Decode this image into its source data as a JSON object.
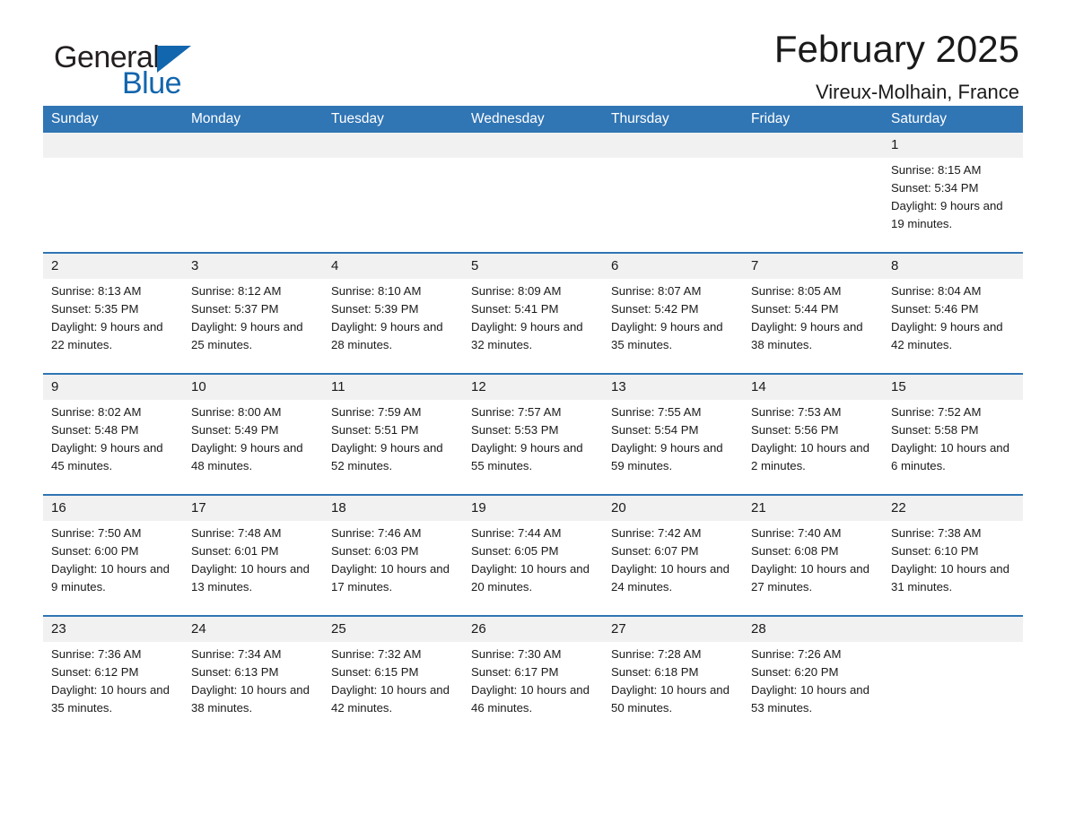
{
  "brand": {
    "name_top": "General",
    "name_bottom": "Blue",
    "accent_color": "#1266ae"
  },
  "header": {
    "title": "February 2025",
    "subtitle": "Vireux-Molhain, France"
  },
  "theme": {
    "header_blue": "#3075b4",
    "daynum_gray": "#f1f1f1",
    "text": "#1a1a1a"
  },
  "calendar": {
    "weekday_headers": [
      "Sunday",
      "Monday",
      "Tuesday",
      "Wednesday",
      "Thursday",
      "Friday",
      "Saturday"
    ],
    "labels": {
      "sunrise": "Sunrise:",
      "sunset": "Sunset:",
      "daylight": "Daylight:"
    },
    "weeks": [
      [
        {
          "day": "",
          "sunrise": "",
          "sunset": "",
          "daylight": ""
        },
        {
          "day": "",
          "sunrise": "",
          "sunset": "",
          "daylight": ""
        },
        {
          "day": "",
          "sunrise": "",
          "sunset": "",
          "daylight": ""
        },
        {
          "day": "",
          "sunrise": "",
          "sunset": "",
          "daylight": ""
        },
        {
          "day": "",
          "sunrise": "",
          "sunset": "",
          "daylight": ""
        },
        {
          "day": "",
          "sunrise": "",
          "sunset": "",
          "daylight": ""
        },
        {
          "day": "1",
          "sunrise": "Sunrise: 8:15 AM",
          "sunset": "Sunset: 5:34 PM",
          "daylight": "Daylight: 9 hours and 19 minutes."
        }
      ],
      [
        {
          "day": "2",
          "sunrise": "Sunrise: 8:13 AM",
          "sunset": "Sunset: 5:35 PM",
          "daylight": "Daylight: 9 hours and 22 minutes."
        },
        {
          "day": "3",
          "sunrise": "Sunrise: 8:12 AM",
          "sunset": "Sunset: 5:37 PM",
          "daylight": "Daylight: 9 hours and 25 minutes."
        },
        {
          "day": "4",
          "sunrise": "Sunrise: 8:10 AM",
          "sunset": "Sunset: 5:39 PM",
          "daylight": "Daylight: 9 hours and 28 minutes."
        },
        {
          "day": "5",
          "sunrise": "Sunrise: 8:09 AM",
          "sunset": "Sunset: 5:41 PM",
          "daylight": "Daylight: 9 hours and 32 minutes."
        },
        {
          "day": "6",
          "sunrise": "Sunrise: 8:07 AM",
          "sunset": "Sunset: 5:42 PM",
          "daylight": "Daylight: 9 hours and 35 minutes."
        },
        {
          "day": "7",
          "sunrise": "Sunrise: 8:05 AM",
          "sunset": "Sunset: 5:44 PM",
          "daylight": "Daylight: 9 hours and 38 minutes."
        },
        {
          "day": "8",
          "sunrise": "Sunrise: 8:04 AM",
          "sunset": "Sunset: 5:46 PM",
          "daylight": "Daylight: 9 hours and 42 minutes."
        }
      ],
      [
        {
          "day": "9",
          "sunrise": "Sunrise: 8:02 AM",
          "sunset": "Sunset: 5:48 PM",
          "daylight": "Daylight: 9 hours and 45 minutes."
        },
        {
          "day": "10",
          "sunrise": "Sunrise: 8:00 AM",
          "sunset": "Sunset: 5:49 PM",
          "daylight": "Daylight: 9 hours and 48 minutes."
        },
        {
          "day": "11",
          "sunrise": "Sunrise: 7:59 AM",
          "sunset": "Sunset: 5:51 PM",
          "daylight": "Daylight: 9 hours and 52 minutes."
        },
        {
          "day": "12",
          "sunrise": "Sunrise: 7:57 AM",
          "sunset": "Sunset: 5:53 PM",
          "daylight": "Daylight: 9 hours and 55 minutes."
        },
        {
          "day": "13",
          "sunrise": "Sunrise: 7:55 AM",
          "sunset": "Sunset: 5:54 PM",
          "daylight": "Daylight: 9 hours and 59 minutes."
        },
        {
          "day": "14",
          "sunrise": "Sunrise: 7:53 AM",
          "sunset": "Sunset: 5:56 PM",
          "daylight": "Daylight: 10 hours and 2 minutes."
        },
        {
          "day": "15",
          "sunrise": "Sunrise: 7:52 AM",
          "sunset": "Sunset: 5:58 PM",
          "daylight": "Daylight: 10 hours and 6 minutes."
        }
      ],
      [
        {
          "day": "16",
          "sunrise": "Sunrise: 7:50 AM",
          "sunset": "Sunset: 6:00 PM",
          "daylight": "Daylight: 10 hours and 9 minutes."
        },
        {
          "day": "17",
          "sunrise": "Sunrise: 7:48 AM",
          "sunset": "Sunset: 6:01 PM",
          "daylight": "Daylight: 10 hours and 13 minutes."
        },
        {
          "day": "18",
          "sunrise": "Sunrise: 7:46 AM",
          "sunset": "Sunset: 6:03 PM",
          "daylight": "Daylight: 10 hours and 17 minutes."
        },
        {
          "day": "19",
          "sunrise": "Sunrise: 7:44 AM",
          "sunset": "Sunset: 6:05 PM",
          "daylight": "Daylight: 10 hours and 20 minutes."
        },
        {
          "day": "20",
          "sunrise": "Sunrise: 7:42 AM",
          "sunset": "Sunset: 6:07 PM",
          "daylight": "Daylight: 10 hours and 24 minutes."
        },
        {
          "day": "21",
          "sunrise": "Sunrise: 7:40 AM",
          "sunset": "Sunset: 6:08 PM",
          "daylight": "Daylight: 10 hours and 27 minutes."
        },
        {
          "day": "22",
          "sunrise": "Sunrise: 7:38 AM",
          "sunset": "Sunset: 6:10 PM",
          "daylight": "Daylight: 10 hours and 31 minutes."
        }
      ],
      [
        {
          "day": "23",
          "sunrise": "Sunrise: 7:36 AM",
          "sunset": "Sunset: 6:12 PM",
          "daylight": "Daylight: 10 hours and 35 minutes."
        },
        {
          "day": "24",
          "sunrise": "Sunrise: 7:34 AM",
          "sunset": "Sunset: 6:13 PM",
          "daylight": "Daylight: 10 hours and 38 minutes."
        },
        {
          "day": "25",
          "sunrise": "Sunrise: 7:32 AM",
          "sunset": "Sunset: 6:15 PM",
          "daylight": "Daylight: 10 hours and 42 minutes."
        },
        {
          "day": "26",
          "sunrise": "Sunrise: 7:30 AM",
          "sunset": "Sunset: 6:17 PM",
          "daylight": "Daylight: 10 hours and 46 minutes."
        },
        {
          "day": "27",
          "sunrise": "Sunrise: 7:28 AM",
          "sunset": "Sunset: 6:18 PM",
          "daylight": "Daylight: 10 hours and 50 minutes."
        },
        {
          "day": "28",
          "sunrise": "Sunrise: 7:26 AM",
          "sunset": "Sunset: 6:20 PM",
          "daylight": "Daylight: 10 hours and 53 minutes."
        },
        {
          "day": "",
          "sunrise": "",
          "sunset": "",
          "daylight": ""
        }
      ]
    ]
  }
}
